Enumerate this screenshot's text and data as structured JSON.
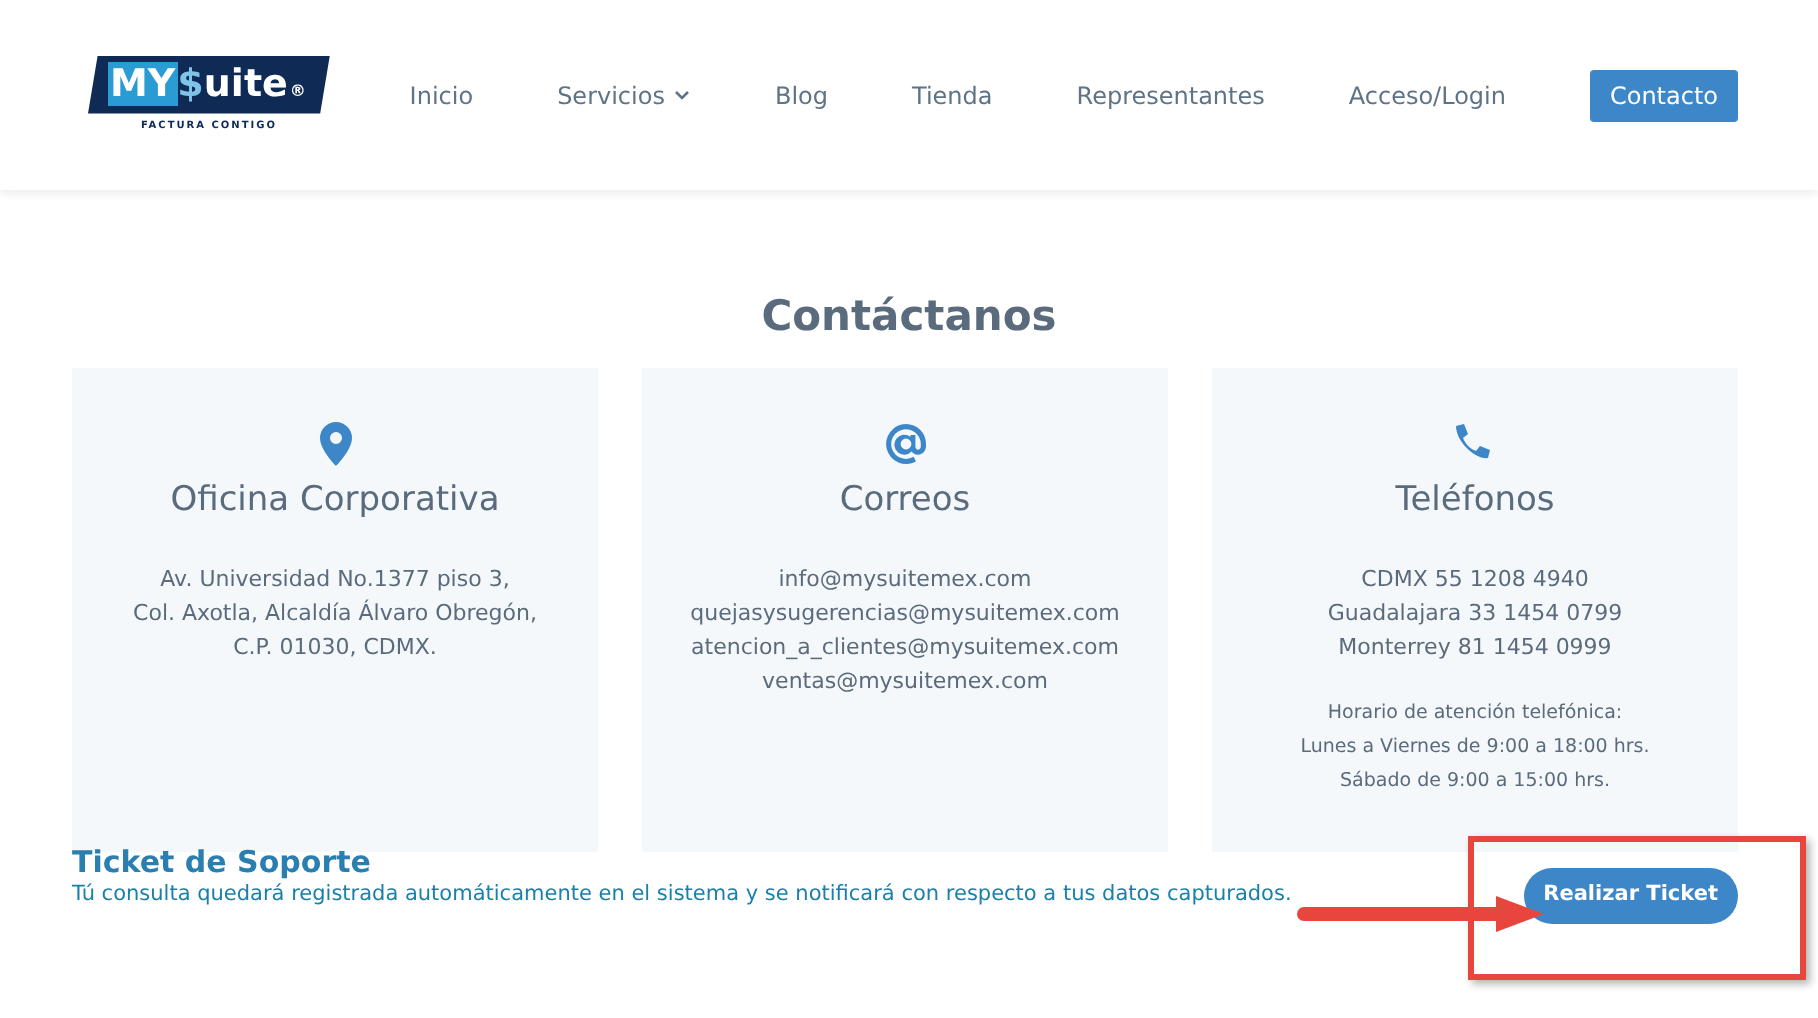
{
  "logo": {
    "brand_start": "MY",
    "brand_mark": "$",
    "brand_end": "uite",
    "registered": "®",
    "tagline": "FACTURA CONTIGO"
  },
  "nav": [
    {
      "label": "Inicio",
      "kind": "link"
    },
    {
      "label": "Servicios",
      "kind": "dropdown"
    },
    {
      "label": "Blog",
      "kind": "link"
    },
    {
      "label": "Tienda",
      "kind": "link"
    },
    {
      "label": "Representantes",
      "kind": "link"
    },
    {
      "label": "Acceso/Login",
      "kind": "link"
    },
    {
      "label": "Contacto",
      "kind": "button"
    }
  ],
  "title": "Contáctanos",
  "cards": [
    {
      "heading": "Oficina Corporativa",
      "lines": [
        "Av. Universidad No.1377 piso 3,",
        "Col. Axotla, Alcaldía Álvaro Obregón,",
        "C.P. 01030, CDMX."
      ]
    },
    {
      "heading": "Correos",
      "lines": [
        "info@mysuitemex.com",
        "quejasysugerencias@mysuitemex.com",
        "atencion_a_clientes@mysuitemex.com",
        "ventas@mysuitemex.com"
      ]
    },
    {
      "heading": "Teléfonos",
      "lines": [
        "CDMX 55 1208 4940",
        "Guadalajara 33 1454 0799",
        "Monterrey 81 1454 0999"
      ],
      "note_lines": [
        "Horario de atención telefónica:",
        "Lunes a Viernes de 9:00 a 18:00 hrs.",
        "Sábado de 9:00 a 15:00 hrs."
      ]
    }
  ],
  "ticket": {
    "heading": "Ticket de Soporte",
    "text": "Tú consulta quedará registrada automáticamente en el sistema y se notificará con respecto a tus datos capturados.",
    "button": "Realizar Ticket"
  },
  "annotation": {
    "highlight": true
  }
}
